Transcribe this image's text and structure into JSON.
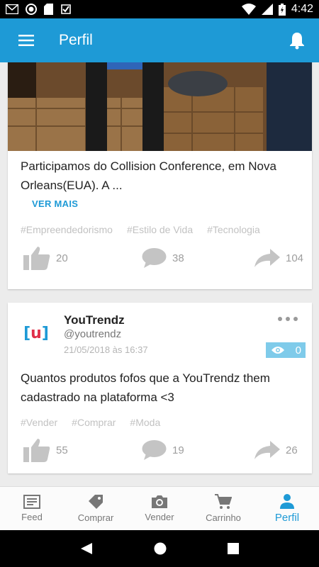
{
  "status_bar": {
    "time": "4:42",
    "icons": [
      "gmail-icon",
      "record-icon",
      "sd-card-icon",
      "check-icon",
      "wifi-icon",
      "signal-icon",
      "battery-icon"
    ]
  },
  "app_bar": {
    "title": "Perfil",
    "color": "#1e9ad6",
    "icons": [
      "menu-icon",
      "bell-icon"
    ]
  },
  "posts": [
    {
      "text": "Participamos do Collision Conference, em Nova Orleans(EUA). A ...",
      "see_more": "VER MAIS",
      "tags": [
        "#Empreendedorismo",
        "#Estilo de Vida",
        "#Tecnologia"
      ],
      "likes": "20",
      "comments": "38",
      "shares": "104"
    },
    {
      "author": {
        "name": "YouTrendz",
        "handle": "@youtrendz",
        "date": "21/05/2018 às 16:37",
        "logo_left": "[",
        "logo_mid": "u",
        "logo_right": "]"
      },
      "views": "0",
      "text": "Quantos produtos fofos que a YouTrendz them cadastrado na plataforma <3",
      "tags": [
        "#Vender",
        "#Comprar",
        "#Moda"
      ],
      "likes": "55",
      "comments": "19",
      "shares": "26"
    }
  ],
  "bottom_nav": {
    "items": [
      {
        "label": "Feed",
        "icon": "feed-icon"
      },
      {
        "label": "Comprar",
        "icon": "tag-icon"
      },
      {
        "label": "Vender",
        "icon": "camera-icon"
      },
      {
        "label": "Carrinho",
        "icon": "cart-icon"
      },
      {
        "label": "Perfil",
        "icon": "person-icon"
      }
    ],
    "active": "Perfil"
  },
  "colors": {
    "accent": "#1e9ad6",
    "views_badge": "#7fcbea",
    "brand_red": "#e0304a"
  }
}
